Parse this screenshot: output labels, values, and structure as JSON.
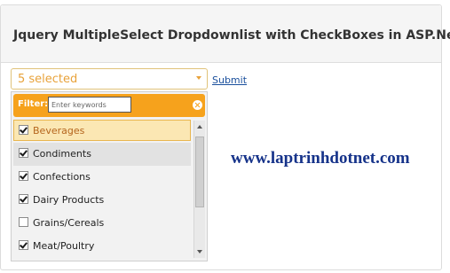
{
  "panel": {
    "title": "Jquery MultipleSelect Dropdownlist with CheckBoxes in ASP.Net"
  },
  "select": {
    "selected_text": "5 selected"
  },
  "submit_label": "Submit",
  "filter": {
    "label": "Filter:",
    "placeholder": "Enter keywords",
    "value": ""
  },
  "items": [
    {
      "label": "Beverages",
      "checked": true
    },
    {
      "label": "Condiments",
      "checked": true
    },
    {
      "label": "Confections",
      "checked": true
    },
    {
      "label": "Dairy Products",
      "checked": true
    },
    {
      "label": "Grains/Cereals",
      "checked": false
    },
    {
      "label": "Meat/Poultry",
      "checked": true
    }
  ],
  "watermark": "www.laptrinhdotnet.com",
  "colors": {
    "accent": "#f6a21c",
    "select_text": "#e8a23a",
    "link": "#1a4f9c",
    "watermark": "#16338a"
  }
}
